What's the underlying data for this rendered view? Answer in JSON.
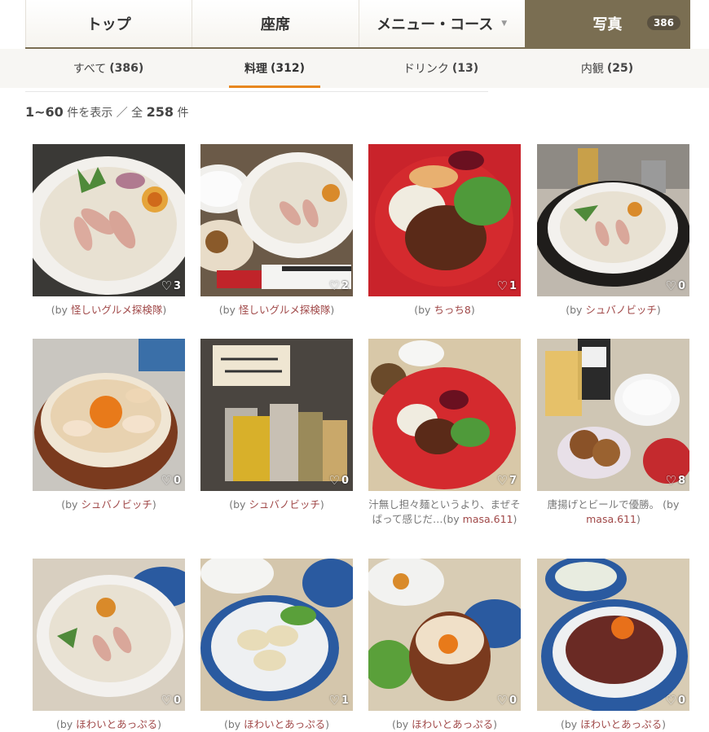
{
  "tabs": [
    {
      "label": "トップ"
    },
    {
      "label": "座席"
    },
    {
      "label": "メニュー・コース"
    },
    {
      "label": "写真",
      "count": "386"
    }
  ],
  "subtabs": [
    {
      "label": "すべて",
      "count": "(386)"
    },
    {
      "label": "料理",
      "count": "(312)"
    },
    {
      "label": "ドリンク",
      "count": "(13)"
    },
    {
      "label": "内観",
      "count": "(25)"
    }
  ],
  "summary": {
    "range": "1~60",
    "shown": "件を表示 ／ 全",
    "total": "258",
    "unit": "件"
  },
  "photos": [
    {
      "likes": "3",
      "by": "(by",
      "author": "怪しいグルメ探検隊",
      "close": ")",
      "text": ""
    },
    {
      "likes": "2",
      "by": "(by",
      "author": "怪しいグルメ探検隊",
      "close": ")",
      "text": ""
    },
    {
      "likes": "1",
      "by": "(by",
      "author": "ちっち8",
      "close": ")",
      "text": ""
    },
    {
      "likes": "0",
      "by": "(by",
      "author": "シュバノビッチ",
      "close": ")",
      "text": ""
    },
    {
      "likes": "0",
      "by": "(by",
      "author": "シュバノビッチ",
      "close": ")",
      "text": ""
    },
    {
      "likes": "0",
      "by": "(by",
      "author": "シュバノビッチ",
      "close": ")",
      "text": ""
    },
    {
      "likes": "7",
      "by": "(by",
      "author": "masa.611",
      "close": ")",
      "text": "汁無し担々麺というより、まぜそばって感じだ…"
    },
    {
      "likes": "8",
      "by": "(by",
      "author": "masa.611",
      "close": ")",
      "text": "唐揚げとビールで優勝。"
    },
    {
      "likes": "0",
      "by": "(by",
      "author": "ほわいとあっぷる",
      "close": ")",
      "text": ""
    },
    {
      "likes": "1",
      "by": "(by",
      "author": "ほわいとあっぷる",
      "close": ")",
      "text": ""
    },
    {
      "likes": "0",
      "by": "(by",
      "author": "ほわいとあっぷる",
      "close": ")",
      "text": ""
    },
    {
      "likes": "0",
      "by": "(by",
      "author": "ほわいとあっぷる",
      "close": ")",
      "text": ""
    }
  ]
}
